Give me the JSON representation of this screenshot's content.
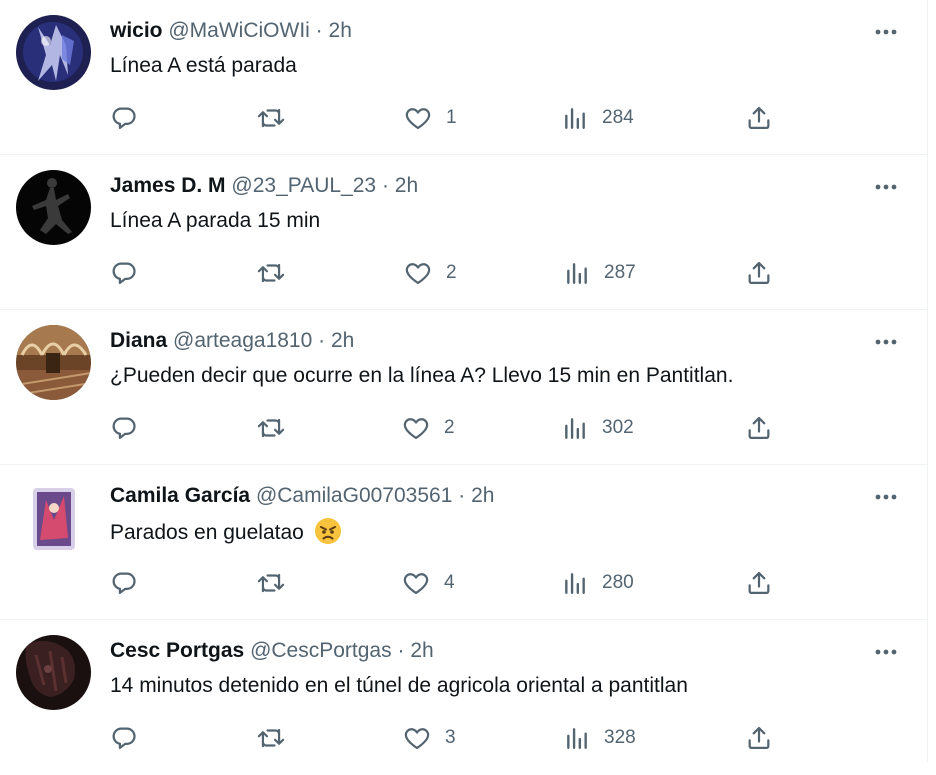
{
  "tweets": [
    {
      "name": "wicio",
      "handle": "@MaWiCiOWIi",
      "sep": "·",
      "time": "2h",
      "text": "Línea A está parada",
      "likes": "1",
      "views": "284",
      "avatar_color": "#2a2f7a"
    },
    {
      "name": "James D. M",
      "handle": "@23_PAUL_23",
      "sep": "·",
      "time": "2h",
      "text": "Línea A parada 15 min",
      "likes": "2",
      "views": "287",
      "avatar_color": "#050505"
    },
    {
      "name": "Diana",
      "handle": "@arteaga1810",
      "sep": "·",
      "time": "2h",
      "text": "¿Pueden decir que ocurre en la línea A? Llevo 15 min en Pantitlan.",
      "likes": "2",
      "views": "302",
      "avatar_color": "#8a5a3a"
    },
    {
      "name": "Camila García",
      "handle": "@CamilaG00703561",
      "sep": "·",
      "time": "2h",
      "text": "Parados en guelatao",
      "emoji": "angry-face",
      "likes": "4",
      "views": "280",
      "avatar_color": "#d8d0e8"
    },
    {
      "name": "Cesc Portgas",
      "handle": "@CescPortgas",
      "sep": "·",
      "time": "2h",
      "text": "14 minutos detenido en el túnel de agricola oriental a pantitlan",
      "likes": "3",
      "views": "328",
      "avatar_color": "#1a1010"
    }
  ],
  "icons": {
    "reply": "reply-icon",
    "retweet": "retweet-icon",
    "like": "heart-icon",
    "views": "views-icon",
    "share": "share-icon",
    "more": "more-icon"
  },
  "colors": {
    "text": "#0f1419",
    "secondary": "#536471",
    "divider": "#eff3f4",
    "background": "#ffffff"
  }
}
